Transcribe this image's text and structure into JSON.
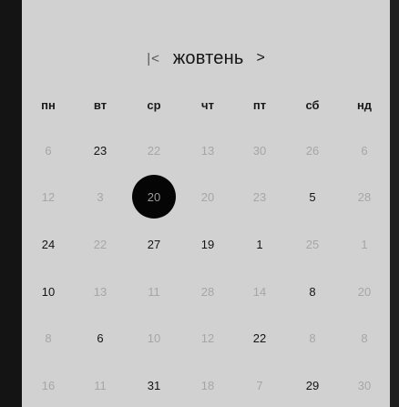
{
  "calendar": {
    "month": "жовтень",
    "prev_icon": "|<",
    "next_icon": ">",
    "weekdays": [
      "пн",
      "вт",
      "ср",
      "чт",
      "пт",
      "сб",
      "нд"
    ],
    "rows": [
      [
        {
          "label": "6",
          "state": "dim"
        },
        {
          "label": "23",
          "state": "on"
        },
        {
          "label": "22",
          "state": "dim"
        },
        {
          "label": "13",
          "state": "dim"
        },
        {
          "label": "30",
          "state": "dim"
        },
        {
          "label": "26",
          "state": "dim"
        },
        {
          "label": "6",
          "state": "dim"
        }
      ],
      [
        {
          "label": "12",
          "state": "dim"
        },
        {
          "label": "3",
          "state": "dim"
        },
        {
          "label": "20",
          "state": "sel"
        },
        {
          "label": "20",
          "state": "dim"
        },
        {
          "label": "23",
          "state": "dim"
        },
        {
          "label": "5",
          "state": "on"
        },
        {
          "label": "28",
          "state": "dim"
        }
      ],
      [
        {
          "label": "24",
          "state": "on"
        },
        {
          "label": "22",
          "state": "dim"
        },
        {
          "label": "27",
          "state": "on"
        },
        {
          "label": "19",
          "state": "on"
        },
        {
          "label": "1",
          "state": "on"
        },
        {
          "label": "25",
          "state": "dim"
        },
        {
          "label": "1",
          "state": "dim"
        }
      ],
      [
        {
          "label": "10",
          "state": "on"
        },
        {
          "label": "13",
          "state": "dim"
        },
        {
          "label": "11",
          "state": "dim"
        },
        {
          "label": "28",
          "state": "dim"
        },
        {
          "label": "14",
          "state": "dim"
        },
        {
          "label": "8",
          "state": "on"
        },
        {
          "label": "20",
          "state": "dim"
        }
      ],
      [
        {
          "label": "8",
          "state": "dim"
        },
        {
          "label": "6",
          "state": "on"
        },
        {
          "label": "10",
          "state": "dim"
        },
        {
          "label": "12",
          "state": "dim"
        },
        {
          "label": "22",
          "state": "on"
        },
        {
          "label": "8",
          "state": "dim"
        },
        {
          "label": "8",
          "state": "dim"
        }
      ],
      [
        {
          "label": "16",
          "state": "dim"
        },
        {
          "label": "11",
          "state": "dim"
        },
        {
          "label": "31",
          "state": "on"
        },
        {
          "label": "18",
          "state": "dim"
        },
        {
          "label": "7",
          "state": "dim"
        },
        {
          "label": "29",
          "state": "on"
        },
        {
          "label": "30",
          "state": "dim"
        }
      ]
    ]
  },
  "colors": {
    "panel": "#d1d1d1",
    "frame": "#141414",
    "selected_bg": "#050505",
    "active_text": "#141414",
    "dim_text": "#a6a6a6"
  }
}
